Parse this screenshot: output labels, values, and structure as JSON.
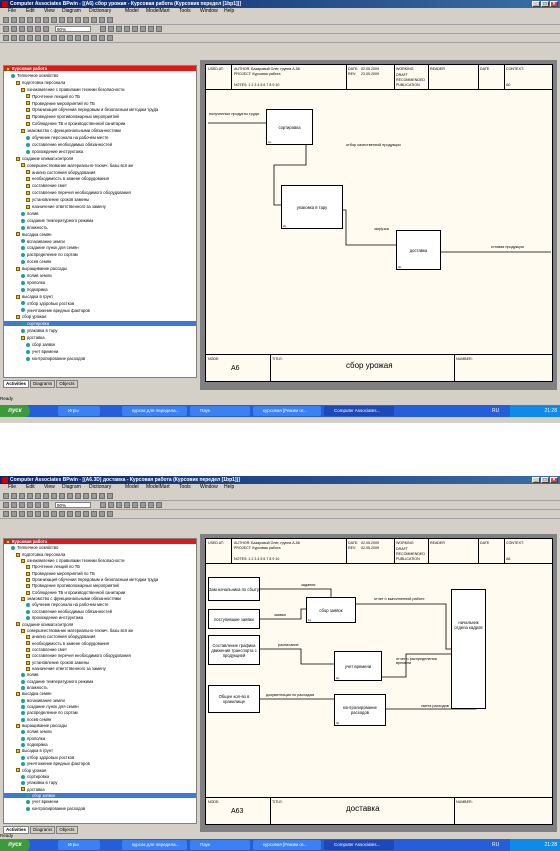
{
  "menu": [
    "File",
    "Edit",
    "View",
    "Diagram",
    "Dictionary",
    "Model",
    "ModelMart",
    "Tools",
    "Window",
    "Help"
  ],
  "zoom": "90%",
  "panel_tabs": [
    "Activities",
    "Diagrams",
    "Objects"
  ],
  "status_text": "Ready",
  "start_label": "пуск",
  "clock": "21:28",
  "kb_layout": "RU",
  "tree": [
    {
      "t": "Курсовая работа",
      "lv": 0,
      "k": "root"
    },
    {
      "t": "Тепличное хозяйство",
      "lv": 1,
      "k": "l"
    },
    {
      "t": "подготовка персонала",
      "lv": 2,
      "k": "f"
    },
    {
      "t": "ознакомление с правилами техники безопасности",
      "lv": 3,
      "k": "f"
    },
    {
      "t": "Прочтение лекций по ТБ",
      "lv": 4,
      "k": "f"
    },
    {
      "t": "Проведение мероприятий по ТБ",
      "lv": 4,
      "k": "f"
    },
    {
      "t": "Организация обучения  передовым и безопасным методам труда",
      "lv": 4,
      "k": "f"
    },
    {
      "t": "Проведение  противопожарных мероприятий",
      "lv": 4,
      "k": "f"
    },
    {
      "t": "Соблюдение ТБ  и производственной санитарии",
      "lv": 4,
      "k": "f"
    },
    {
      "t": "знакомство с  функциональными обязанностями",
      "lv": 3,
      "k": "f"
    },
    {
      "t": "обучение персонала на рабочем месте",
      "lv": 4,
      "k": "l"
    },
    {
      "t": "составление необходимых обязанностей",
      "lv": 4,
      "k": "l"
    },
    {
      "t": "прохождение инструктажа",
      "lv": 4,
      "k": "l"
    },
    {
      "t": "создание климат.контроля",
      "lv": 2,
      "k": "f"
    },
    {
      "t": "совершенствование  материально-технич. базы вся же",
      "lv": 3,
      "k": "f"
    },
    {
      "t": "анализ состояния оборудования",
      "lv": 4,
      "k": "f"
    },
    {
      "t": "необходимость в замене оборудования",
      "lv": 4,
      "k": "f"
    },
    {
      "t": "составление смет",
      "lv": 4,
      "k": "f"
    },
    {
      "t": "составление перечня необходимого оборудования",
      "lv": 4,
      "k": "f"
    },
    {
      "t": "установление сроков замены",
      "lv": 4,
      "k": "f"
    },
    {
      "t": "назначение ответственного за замену",
      "lv": 4,
      "k": "f"
    },
    {
      "t": "полив",
      "lv": 3,
      "k": "l"
    },
    {
      "t": "создание  температурного режима",
      "lv": 3,
      "k": "l"
    },
    {
      "t": "влажность",
      "lv": 3,
      "k": "l"
    },
    {
      "t": "высадка семян",
      "lv": 2,
      "k": "f"
    },
    {
      "t": "вспахивание земли",
      "lv": 3,
      "k": "l"
    },
    {
      "t": "создание лунок для семян",
      "lv": 3,
      "k": "l"
    },
    {
      "t": "распределение  по сортам",
      "lv": 3,
      "k": "l"
    },
    {
      "t": "посев семян",
      "lv": 3,
      "k": "l"
    },
    {
      "t": "выращивание рассады",
      "lv": 2,
      "k": "f"
    },
    {
      "t": "полив земли",
      "lv": 3,
      "k": "l"
    },
    {
      "t": "прополка",
      "lv": 3,
      "k": "l"
    },
    {
      "t": "подкормка",
      "lv": 3,
      "k": "l"
    },
    {
      "t": "высадка в грунт",
      "lv": 2,
      "k": "f"
    },
    {
      "t": "отбор здоровых ростков",
      "lv": 3,
      "k": "l"
    },
    {
      "t": "уничтожение вредных факторов",
      "lv": 3,
      "k": "l"
    },
    {
      "t": "сбор урожая",
      "lv": 2,
      "k": "f"
    },
    {
      "t": "сортировка",
      "lv": 3,
      "k": "l"
    },
    {
      "t": "упаковка в тару",
      "lv": 3,
      "k": "l"
    },
    {
      "t": "доставка",
      "lv": 3,
      "k": "f"
    },
    {
      "t": "сбор заявок",
      "lv": 4,
      "k": "l"
    },
    {
      "t": "учет времени",
      "lv": 4,
      "k": "l"
    },
    {
      "t": "контролирование расходов",
      "lv": 4,
      "k": "l"
    }
  ],
  "header": {
    "used_at": "USED AT:",
    "author": "AUTHOR:  Базаровый Олег, группа А-56",
    "project": "PROJECT:  Курсовая работа",
    "notes": "NOTES:  1  2  3  4  5  6  7  8  9  10",
    "date": "DATE:",
    "rev": "REV:",
    "working": "WORKING",
    "draft": "DRAFT",
    "recommended": "RECOMMENDED",
    "publication": "PUBLICATION",
    "reader": "READER",
    "date2": "DATE",
    "context": "CONTEXT:"
  },
  "top": {
    "title_bar": "Computer Associates BPwin - [(A6) сбор урожая - Курсовая работа  (Курсовик передел [1bp1])]",
    "date_val": "02.05.2009",
    "rev_val": "23.05.2009",
    "ctx_code": "A0",
    "selected_row": 37,
    "node": "A6",
    "diagram_title": "сбор урожая",
    "boxes": [
      {
        "label": "сортировка",
        "num": "1р"
      },
      {
        "label": "упаковка в тару",
        "num": "2р"
      },
      {
        "label": "доставка",
        "num": "3р"
      }
    ],
    "arrows": [
      "полученные продукты труда",
      "отбор качественной продукции",
      "загрузка",
      "готовая продукция"
    ],
    "taskbar": [
      {
        "label": "Игры"
      },
      {
        "label": "курсак для передела..."
      },
      {
        "label": "Паук"
      },
      {
        "label": "курсовая [Режим ог..."
      },
      {
        "label": "Computer Associates..."
      }
    ]
  },
  "bottom": {
    "title_bar": "Computer Associates BPwin - [(A6.3D) доставка - Курсовая работа  (Курсовик передел [1bp1])]",
    "date_val": "02.05.2009",
    "rev_val": "02.05.2009",
    "ctx_code": "A6",
    "selected_row": 40,
    "node": "A63",
    "diagram_title": "доставка",
    "inputs": [
      "Зам.начальника по сбыту",
      "поступившие заявки",
      "Составление графика движения транспорта с продукцией",
      "Общее кол-во в хранилище"
    ],
    "boxes": [
      {
        "label": "сбор заявок",
        "num": "1р"
      },
      {
        "label": "учет времени",
        "num": "2р"
      },
      {
        "label": "контролирование расходов",
        "num": "3р"
      }
    ],
    "output_box": "начальник отдела кадров",
    "arrows": [
      "задания",
      "заявки",
      "расписание",
      "документация по расходам",
      "отчет о выполненной работе",
      "отчет о распределении времени",
      "смета расходов"
    ],
    "taskbar": [
      {
        "label": "Игры"
      },
      {
        "label": "курсак для передела..."
      },
      {
        "label": "Паук"
      },
      {
        "label": "курсовая [Режим ог..."
      },
      {
        "label": "Computer Associates..."
      }
    ]
  }
}
